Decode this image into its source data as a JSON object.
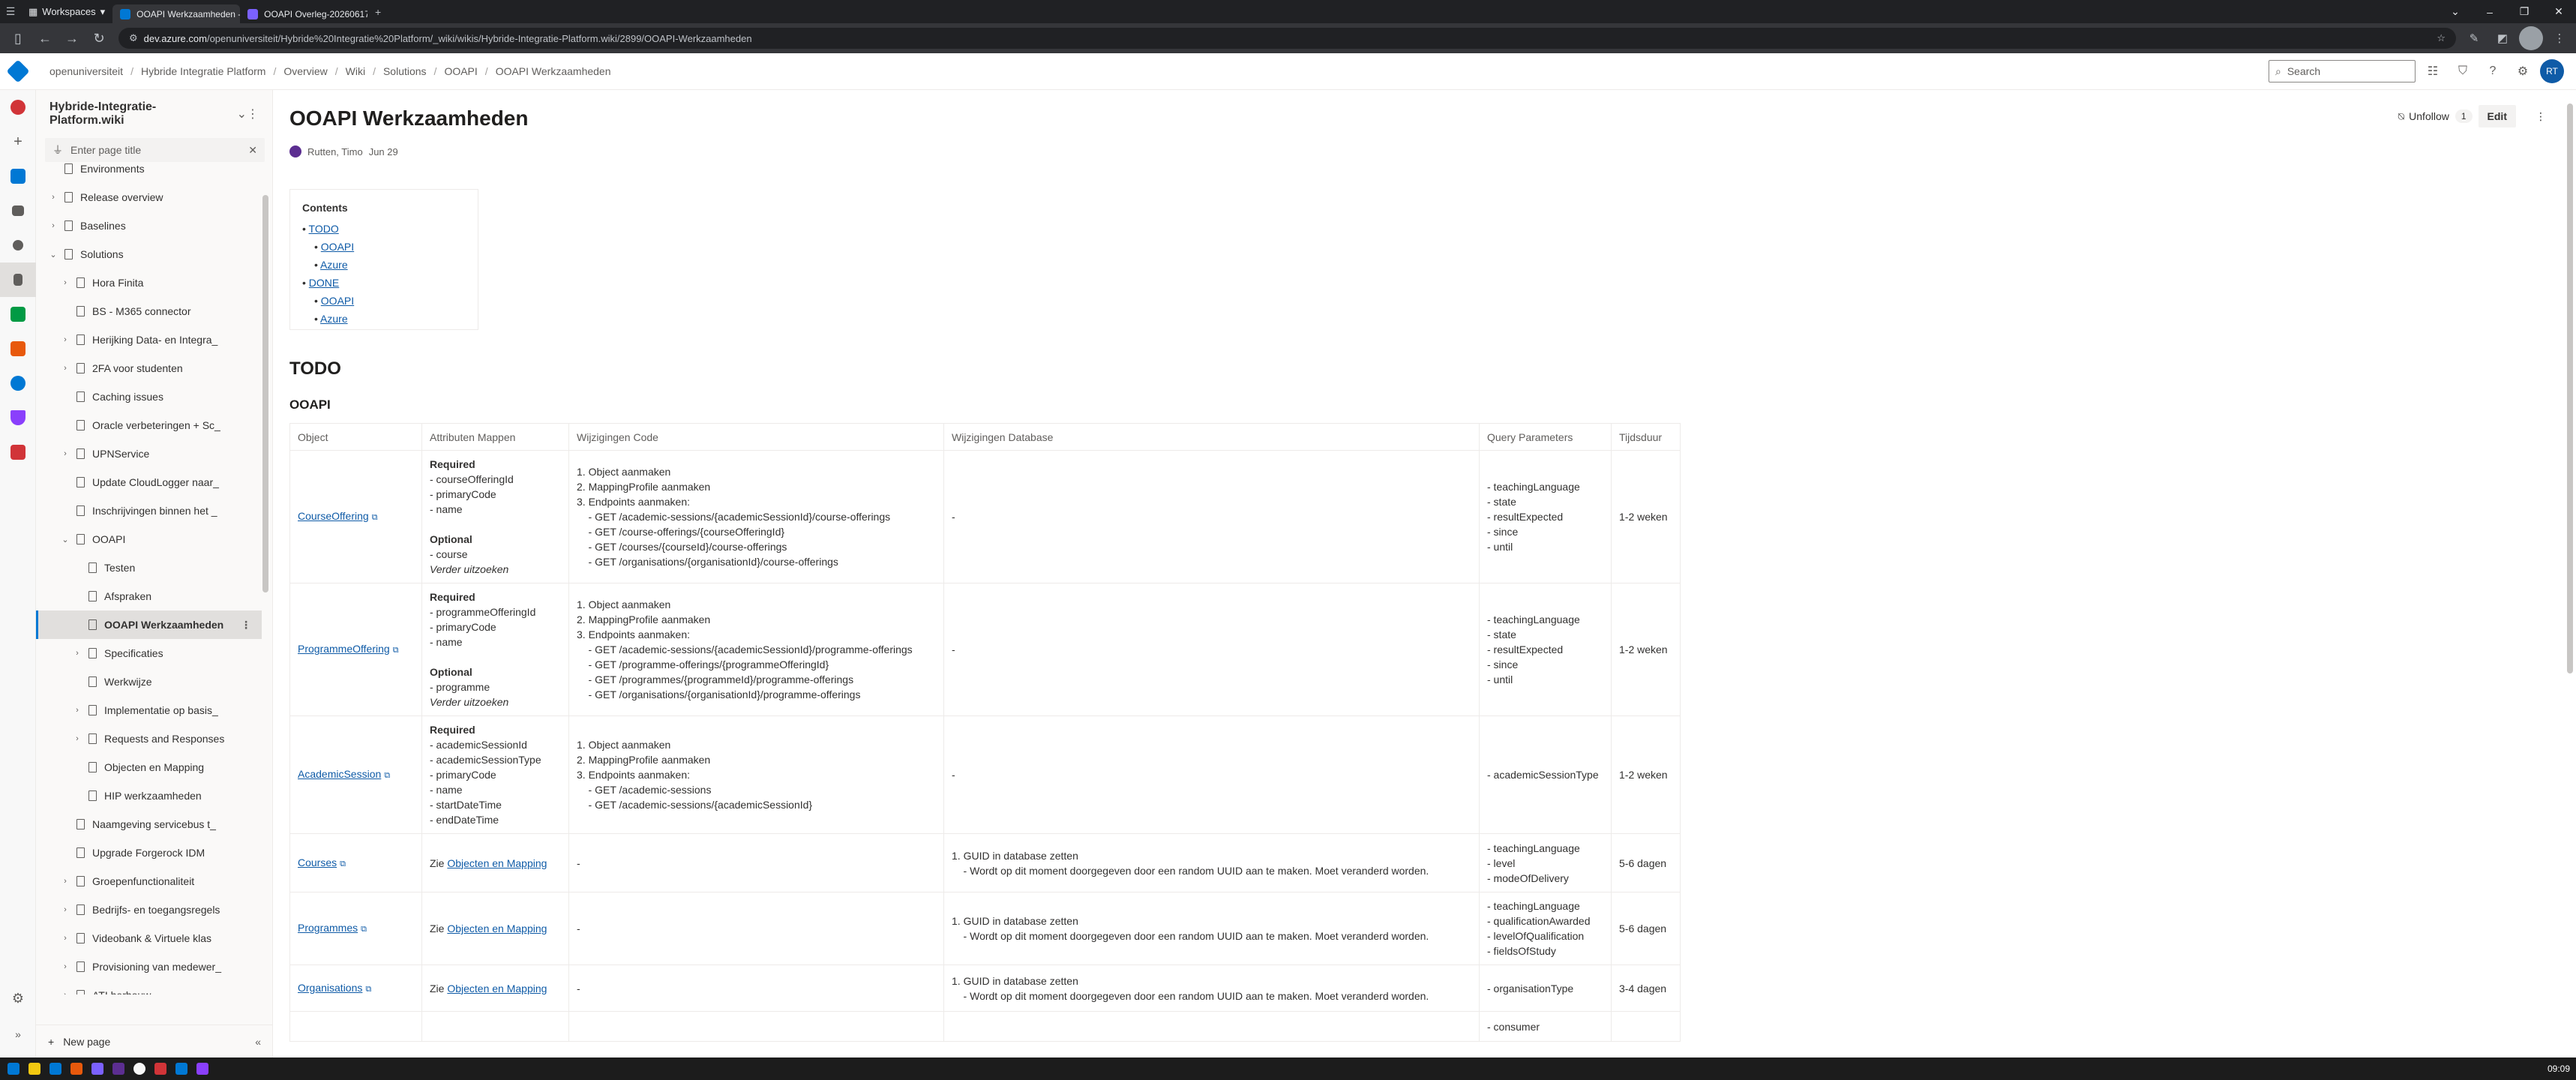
{
  "browser": {
    "workspace_label": "Workspaces",
    "tabs": [
      {
        "label": "OOAPI Werkzaamheden - ",
        "active": true
      },
      {
        "label": "OOAPI Overleg-20260617_",
        "active": false
      }
    ],
    "url_host": "dev.azure.com",
    "url_path": "/openuniversiteit/Hybride%20Integratie%20Platform/_wiki/wikis/Hybride-Integratie-Platform.wiki/2899/OOAPI-Werkzaamheden"
  },
  "breadcrumb": [
    "openuniversiteit",
    "Hybride Integratie Platform",
    "Overview",
    "Wiki",
    "Solutions",
    "OOAPI",
    "OOAPI Werkzaamheden"
  ],
  "header": {
    "search_placeholder": "Search",
    "user_initials": "RT"
  },
  "wiki": {
    "name": "Hybride-Integratie-Platform.wiki",
    "filter_placeholder": "Enter page title",
    "new_page_label": "New page",
    "tree": [
      {
        "label": "Environments",
        "level": 1,
        "chevron": ""
      },
      {
        "label": "Release overview",
        "level": 1,
        "chevron": ">"
      },
      {
        "label": "Baselines",
        "level": 1,
        "chevron": ">"
      },
      {
        "label": "Solutions",
        "level": 1,
        "chevron": "v"
      },
      {
        "label": "Hora Finita",
        "level": 2,
        "chevron": ">"
      },
      {
        "label": "BS - M365 connector",
        "level": 2,
        "chevron": ""
      },
      {
        "label": "Herijking Data- en Integra_",
        "level": 2,
        "chevron": ">"
      },
      {
        "label": "2FA voor studenten",
        "level": 2,
        "chevron": ">"
      },
      {
        "label": "Caching issues",
        "level": 2,
        "chevron": ""
      },
      {
        "label": "Oracle verbeteringen + Sc_",
        "level": 2,
        "chevron": ""
      },
      {
        "label": "UPNService",
        "level": 2,
        "chevron": ">"
      },
      {
        "label": "Update CloudLogger naar_",
        "level": 2,
        "chevron": ""
      },
      {
        "label": "Inschrijvingen binnen het _",
        "level": 2,
        "chevron": ""
      },
      {
        "label": "OOAPI",
        "level": 2,
        "chevron": "v"
      },
      {
        "label": "Testen",
        "level": 3,
        "chevron": ""
      },
      {
        "label": "Afspraken",
        "level": 3,
        "chevron": ""
      },
      {
        "label": "OOAPI Werkzaamheden",
        "level": 3,
        "chevron": "",
        "selected": true
      },
      {
        "label": "Specificaties",
        "level": 3,
        "chevron": ">"
      },
      {
        "label": "Werkwijze",
        "level": 3,
        "chevron": ""
      },
      {
        "label": "Implementatie op basis_",
        "level": 3,
        "chevron": ">"
      },
      {
        "label": "Requests and Responses",
        "level": 3,
        "chevron": ">"
      },
      {
        "label": "Objecten en Mapping",
        "level": 3,
        "chevron": ""
      },
      {
        "label": "HIP werkzaamheden",
        "level": 3,
        "chevron": ""
      },
      {
        "label": "Naamgeving servicebus t_",
        "level": 2,
        "chevron": ""
      },
      {
        "label": "Upgrade Forgerock IDM",
        "level": 2,
        "chevron": ""
      },
      {
        "label": "Groepenfunctionaliteit",
        "level": 2,
        "chevron": ">"
      },
      {
        "label": "Bedrijfs- en toegangsregels",
        "level": 2,
        "chevron": ">"
      },
      {
        "label": "Videobank & Virtuele klas",
        "level": 2,
        "chevron": ">"
      },
      {
        "label": "Provisioning van medewer_",
        "level": 2,
        "chevron": ">"
      },
      {
        "label": "ATI herbouw",
        "level": 2,
        "chevron": ">"
      }
    ]
  },
  "page": {
    "title": "OOAPI Werkzaamheden",
    "author": "Rutten, Timo",
    "date": "Jun 29",
    "unfollow_label": "Unfollow",
    "follow_count": "1",
    "edit_label": "Edit",
    "toc_title": "Contents",
    "toc": [
      {
        "label": "TODO",
        "level": 1
      },
      {
        "label": "OOAPI",
        "level": 2
      },
      {
        "label": "Azure",
        "level": 2
      },
      {
        "label": "DONE",
        "level": 1
      },
      {
        "label": "OOAPI",
        "level": 2
      },
      {
        "label": "Azure",
        "level": 2
      }
    ],
    "h1": "TODO",
    "h2": "OOAPI",
    "table": {
      "headers": [
        "Object",
        "Attributen Mappen",
        "Wijzigingen Code",
        "Wijzigingen Database",
        "Query Parameters",
        "Tijdsduur"
      ],
      "rows": [
        {
          "object": "CourseOffering",
          "attr": "Required\n- courseOfferingId\n- primaryCode\n- name\n\nOptional\n- course\nVerder uitzoeken",
          "code": "1. Object aanmaken\n2. MappingProfile aanmaken\n3. Endpoints aanmaken:\n    - GET /academic-sessions/{academicSessionId}/course-offerings\n    - GET /course-offerings/{courseOfferingId}\n    - GET /courses/{courseId}/course-offerings\n    - GET /organisations/{organisationId}/course-offerings",
          "db": "-",
          "query": "- teachingLanguage\n- state\n- resultExpected\n- since\n- until",
          "duur": "1-2 weken"
        },
        {
          "object": "ProgrammeOffering",
          "attr": "Required\n- programmeOfferingId\n- primaryCode\n- name\n\nOptional\n- programme\nVerder uitzoeken",
          "code": "1. Object aanmaken\n2. MappingProfile aanmaken\n3. Endpoints aanmaken:\n    - GET /academic-sessions/{academicSessionId}/programme-offerings\n    - GET /programme-offerings/{programmeOfferingId}\n    - GET /programmes/{programmeId}/programme-offerings\n    - GET /organisations/{organisationId}/programme-offerings",
          "db": "-",
          "query": "- teachingLanguage\n- state\n- resultExpected\n- since\n- until",
          "duur": "1-2 weken"
        },
        {
          "object": "AcademicSession",
          "attr": "Required\n- academicSessionId\n- academicSessionType\n- primaryCode\n- name\n- startDateTime\n- endDateTime",
          "code": "1. Object aanmaken\n2. MappingProfile aanmaken\n3. Endpoints aanmaken:\n    - GET /academic-sessions\n    - GET /academic-sessions/{academicSessionId}",
          "db": "-",
          "query": "- academicSessionType",
          "duur": "1-2 weken"
        },
        {
          "object": "Courses",
          "attr_prefix": "Zie ",
          "attr_link": "Objecten en Mapping",
          "code": "-",
          "db": "1. GUID in database zetten\n    - Wordt op dit moment doorgegeven door een random UUID aan te maken. Moet veranderd worden.",
          "query": "- teachingLanguage\n- level\n- modeOfDelivery",
          "duur": "5-6 dagen"
        },
        {
          "object": "Programmes",
          "attr_prefix": "Zie ",
          "attr_link": "Objecten en Mapping",
          "code": "-",
          "db": "1. GUID in database zetten\n    - Wordt op dit moment doorgegeven door een random UUID aan te maken. Moet veranderd worden.",
          "query": "- teachingLanguage\n- qualificationAwarded\n- levelOfQualification\n- fieldsOfStudy",
          "duur": "5-6 dagen"
        },
        {
          "object": "Organisations",
          "attr_prefix": "Zie ",
          "attr_link": "Objecten en Mapping",
          "code": "-",
          "db": "1. GUID in database zetten\n    - Wordt op dit moment doorgegeven door een random UUID aan te maken. Moet veranderd worden.",
          "query": "- organisationType",
          "duur": "3-4 dagen"
        },
        {
          "object": "",
          "attr": "",
          "code": "",
          "db": "",
          "query": "- consumer",
          "duur": ""
        }
      ]
    }
  },
  "taskbar": {
    "clock": "09:09"
  },
  "colors": {
    "accent": "#0078d4",
    "link": "#0f5ba7",
    "chrome_dark": "#202124"
  }
}
